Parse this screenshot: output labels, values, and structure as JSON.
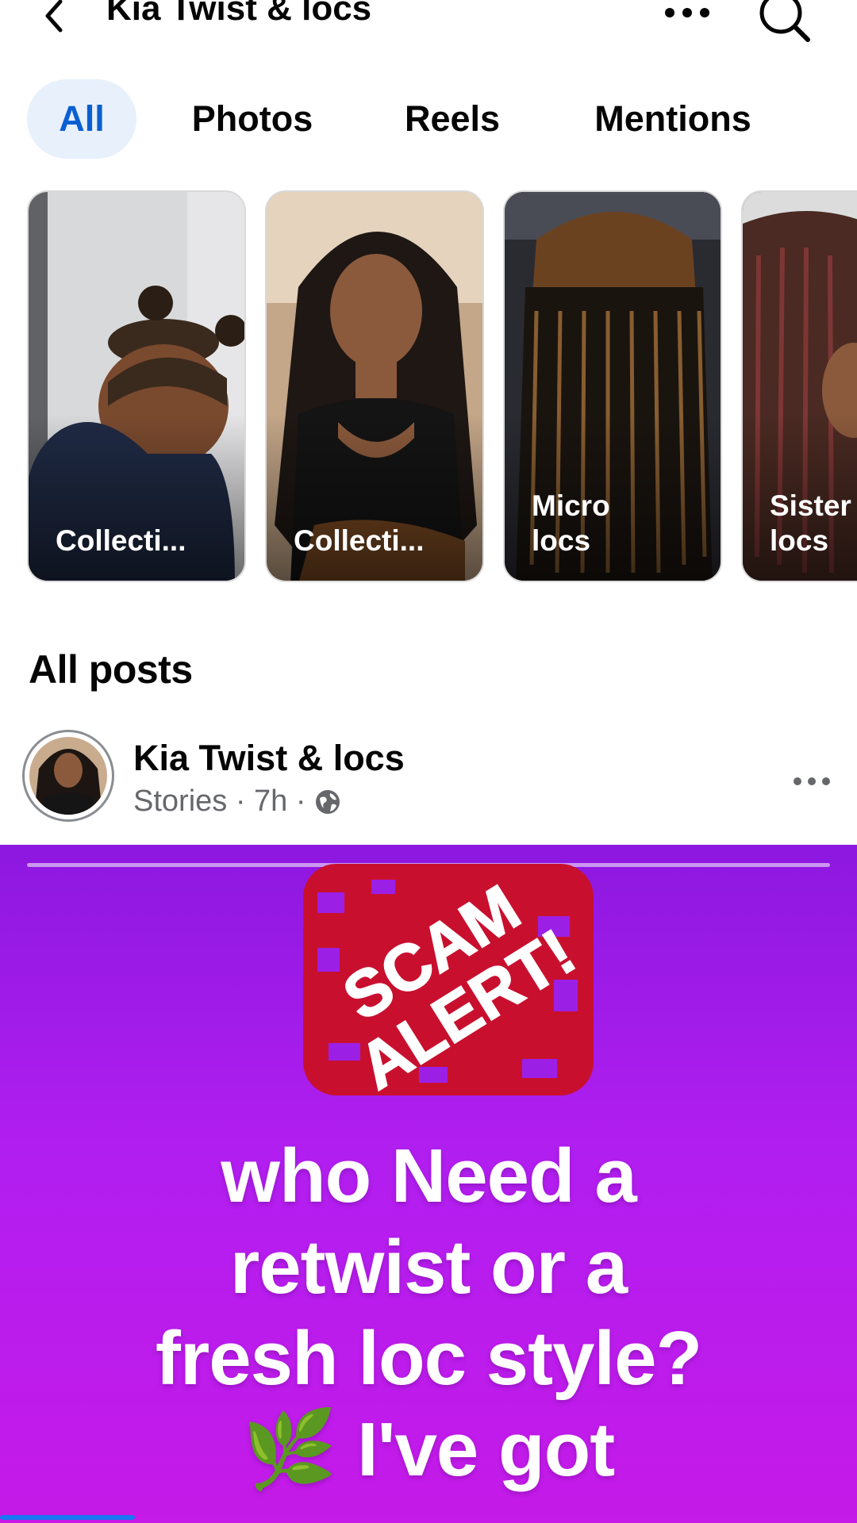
{
  "header": {
    "title": "Kia Twist & locs",
    "back_icon": "chevron-left-icon",
    "more_icon": "more-horizontal-icon",
    "search_icon": "search-icon"
  },
  "tabs": [
    {
      "label": "All",
      "active": true
    },
    {
      "label": "Photos",
      "active": false
    },
    {
      "label": "Reels",
      "active": false
    },
    {
      "label": "Mentions",
      "active": false
    }
  ],
  "albums": [
    {
      "label": "Collecti..."
    },
    {
      "label": "Collecti..."
    },
    {
      "label": "Micro\nlocs"
    },
    {
      "label": "Sister\nlocs"
    }
  ],
  "posts_section": {
    "title": "All posts"
  },
  "post": {
    "author": "Kia Twist & locs",
    "meta": "Stories · 7h ·",
    "privacy_icon": "globe-icon",
    "more_icon": "more-horizontal-icon",
    "story": {
      "badge_text_1": "SCAM",
      "badge_text_2": "ALERT!",
      "text": "who Need a\nretwist or a\nfresh loc style?\n🌿 I've got",
      "background_color": "#b11ef0"
    }
  },
  "colors": {
    "accent": "#0a5fd1",
    "accent_bg": "#e7f0fb",
    "badge_red": "#c8102e"
  }
}
